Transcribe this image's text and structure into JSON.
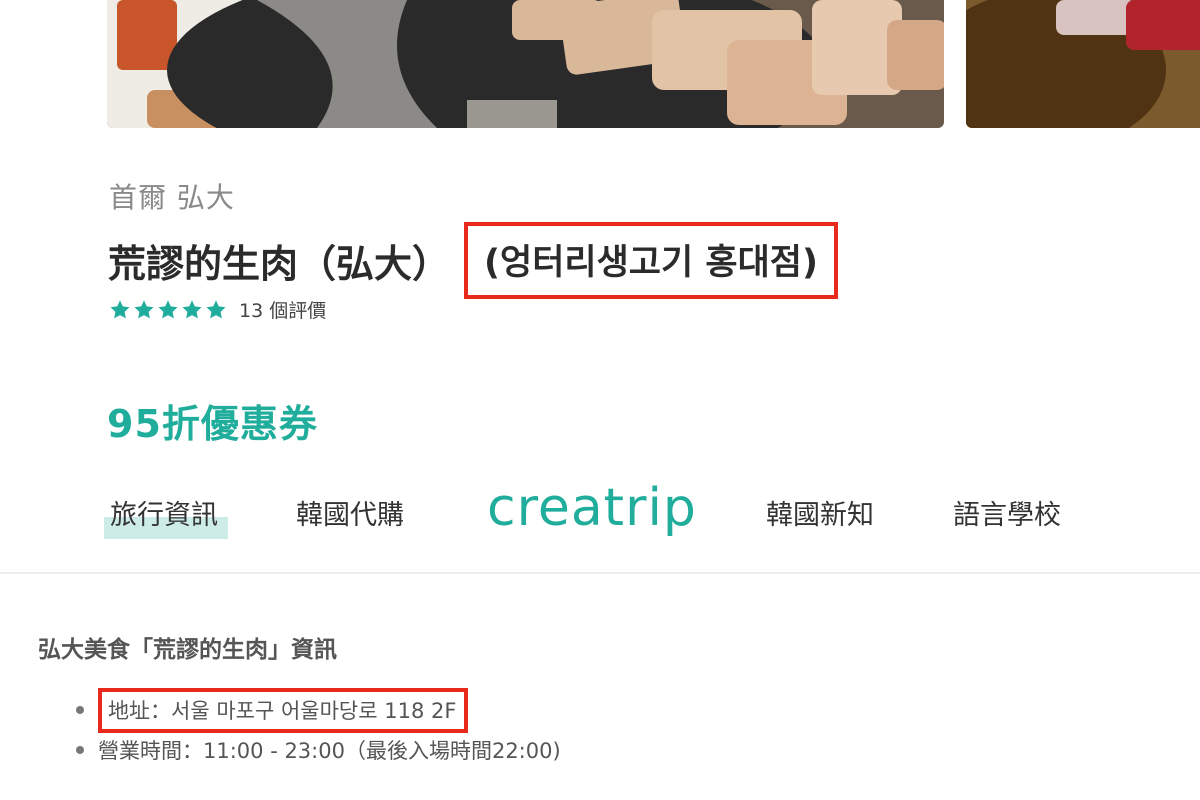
{
  "colors": {
    "accent": "#20ad9b",
    "highlight_box": "#e8291c",
    "nav_active_underline": "#cdece8"
  },
  "photos": [
    {
      "name": "grilled-pork-photo"
    },
    {
      "name": "raw-meat-photo"
    }
  ],
  "restaurant": {
    "location": "首爾 弘大",
    "title": "荒謬的生肉（弘大）",
    "title_korean": "(엉터리생고기 홍대점)",
    "rating": 5,
    "review_count_label": "13 個評價"
  },
  "coupon": {
    "label": "95折優惠券"
  },
  "nav": {
    "items": [
      {
        "label": "旅行資訊",
        "active": true
      },
      {
        "label": "韓國代購",
        "active": false
      },
      {
        "label": "韓國新知",
        "active": false
      },
      {
        "label": "語言學校",
        "active": false
      }
    ],
    "logo_text": "creatrip"
  },
  "info": {
    "heading": "弘大美食「荒謬的生肉」資訊",
    "items": [
      {
        "text": "地址：서울 마포구 어울마당로 118 2F",
        "highlighted": true
      },
      {
        "text": "營業時間：11:00 - 23:00（最後入場時間22:00)",
        "highlighted": false
      }
    ]
  }
}
